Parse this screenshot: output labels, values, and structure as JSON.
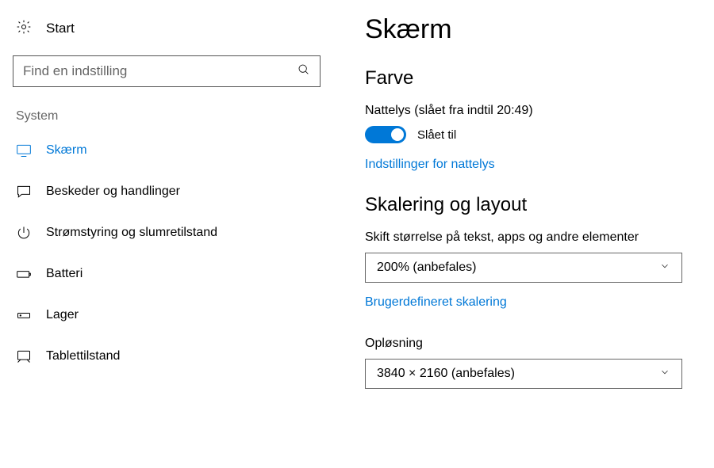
{
  "sidebar": {
    "home": "Start",
    "search_placeholder": "Find en indstilling",
    "category": "System",
    "items": [
      {
        "label": "Skærm",
        "icon": "monitor-icon",
        "active": true
      },
      {
        "label": "Beskeder og handlinger",
        "icon": "chat-icon",
        "active": false
      },
      {
        "label": "Strømstyring og slumretilstand",
        "icon": "power-icon",
        "active": false
      },
      {
        "label": "Batteri",
        "icon": "battery-icon",
        "active": false
      },
      {
        "label": "Lager",
        "icon": "storage-icon",
        "active": false
      },
      {
        "label": "Tablettilstand",
        "icon": "tablet-icon",
        "active": false
      }
    ]
  },
  "main": {
    "title": "Skærm",
    "color_section": {
      "heading": "Farve",
      "nightlight_status": "Nattelys (slået fra indtil 20:49)",
      "toggle_label": "Slået til",
      "nightlight_link": "Indstillinger for nattelys"
    },
    "scaling_section": {
      "heading": "Skalering og layout",
      "scale_label": "Skift størrelse på tekst, apps og andre elementer",
      "scale_value": "200% (anbefales)",
      "custom_link": "Brugerdefineret skalering",
      "resolution_label": "Opløsning",
      "resolution_value": "3840 × 2160 (anbefales)"
    }
  },
  "colors": {
    "accent": "#0078d7"
  }
}
